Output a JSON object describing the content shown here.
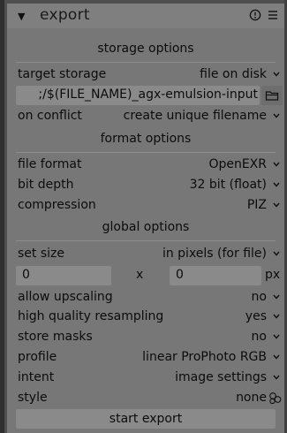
{
  "module": {
    "title": "export",
    "collapse_icon": "triangle-down-icon",
    "reset_icon": "reset-icon",
    "presets_icon": "presets-menu-icon"
  },
  "storage": {
    "heading": "storage options",
    "target_storage_label": "target storage",
    "target_storage_value": "file on disk",
    "path_value": ";/$(FILE_NAME)_agx-emulsion-input",
    "folder_icon": "folder-icon",
    "on_conflict_label": "on conflict",
    "on_conflict_value": "create unique filename"
  },
  "format": {
    "heading": "format options",
    "file_format_label": "file format",
    "file_format_value": "OpenEXR",
    "bit_depth_label": "bit depth",
    "bit_depth_value": "32 bit (float)",
    "compression_label": "compression",
    "compression_value": "PIZ"
  },
  "global": {
    "heading": "global options",
    "set_size_label": "set size",
    "set_size_value": "in pixels (for file)",
    "width_value": "0",
    "size_separator": "x",
    "height_value": "0",
    "size_unit": "px",
    "allow_upscaling_label": "allow upscaling",
    "allow_upscaling_value": "no",
    "hq_resampling_label": "high quality resampling",
    "hq_resampling_value": "yes",
    "store_masks_label": "store masks",
    "store_masks_value": "no",
    "profile_label": "profile",
    "profile_value": "linear ProPhoto RGB",
    "intent_label": "intent",
    "intent_value": "image settings",
    "style_label": "style",
    "style_value": "none",
    "style_icon": "style-circles-icon"
  },
  "actions": {
    "start_export": "start export"
  }
}
